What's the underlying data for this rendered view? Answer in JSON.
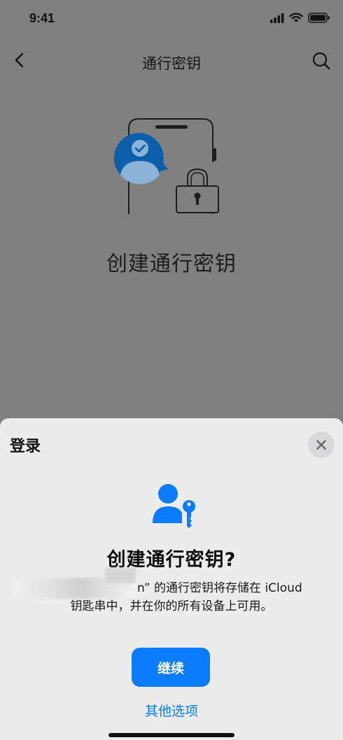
{
  "status_bar": {
    "time": "9:41"
  },
  "nav": {
    "title": "通行密钥"
  },
  "hero": {
    "title": "创建通行密钥"
  },
  "sheet": {
    "title": "登录",
    "heading": "创建通行密钥?",
    "description_line1": "n” 的通行密钥将存储在 iCloud",
    "description_line2": "钥匙串中，并在你的所有设备上可用。",
    "continue_label": "继续",
    "other_options_label": "其他选项"
  },
  "colors": {
    "accent": "#0a7cff",
    "dim_background": "#808080",
    "sheet_background": "#ececec",
    "illustration_blue": "#0b5fa8"
  }
}
